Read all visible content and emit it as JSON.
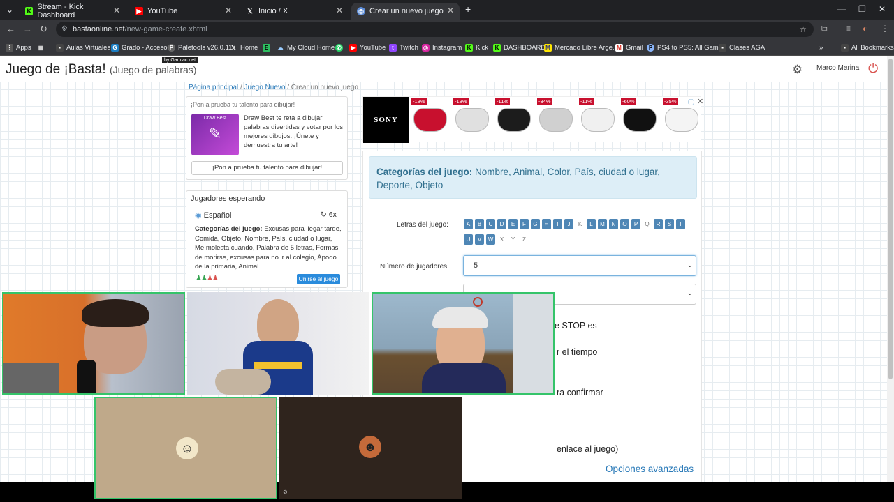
{
  "browser": {
    "tabs": [
      {
        "title": "Stream - Kick Dashboard",
        "icon": "kick-icon"
      },
      {
        "title": "YouTube",
        "icon": "youtube-icon"
      },
      {
        "title": "Inicio / X",
        "icon": "x-icon"
      },
      {
        "title": "Crear un nuevo juego",
        "icon": "globe-icon"
      }
    ],
    "url_domain": "bastaonline.net",
    "url_path": "/new-game-create.xhtml",
    "bookmarks": [
      "Apps",
      "Aulas Virtuales",
      "Grado - Acceso",
      "Paletools v26.0.11",
      "Home",
      "My Cloud Home",
      "YouTube",
      "Twitch",
      "Instagram",
      "Kick",
      "DASHBOARD",
      "Mercado Libre Arge...",
      "Gmail",
      "PS4 to PS5: All Gam...",
      "Clases AGA"
    ],
    "all_bookmarks": "All Bookmarks"
  },
  "site": {
    "title": "Juego de ¡Basta!",
    "subtitle": "(Juego de palabras)",
    "gamiac_badge": "by Gamiac.net",
    "username": "Marco Marina"
  },
  "breadcrumb": {
    "home": "Página principal",
    "new_game": "Juego Nuevo",
    "current": "Crear un nuevo juego"
  },
  "draw_promo": {
    "title": "¡Pon a prueba tu talento para dibujar!",
    "image_text": "Draw Best",
    "text": "Draw Best te reta a dibujar palabras divertidas y votar por los mejores dibujos. ¡Únete y demuestra tu arte!",
    "button": "¡Pon a prueba tu talento para dibujar!"
  },
  "waiting": {
    "title": "Jugadores esperando",
    "language": "Español",
    "count": "6x",
    "categories_label": "Categorías del juego:",
    "categories": "Excusas para llegar tarde, Comida, Objeto, Nombre, País, ciudad o lugar, Me molesta cuando, Palabra de 5 letras, Formas de morirse, excusas para no ir al colegio, Apodo de la primaria, Animal",
    "players_icons": "♟♟♟♟",
    "join_button": "Unirse al juego"
  },
  "ad": {
    "brand": "SONY",
    "items": [
      {
        "discount": "-18%",
        "color": "#c8102e"
      },
      {
        "discount": "-18%",
        "color": "#e0e0e0"
      },
      {
        "discount": "-11%",
        "color": "#1c1c1c"
      },
      {
        "discount": "-34%",
        "color": "#d0d0d0"
      },
      {
        "discount": "-11%",
        "color": "#f0f0f0"
      },
      {
        "discount": "-60%",
        "color": "#111111"
      },
      {
        "discount": "-35%",
        "color": "#f4f4f4"
      }
    ]
  },
  "form": {
    "categories_label": "Categorías del juego:",
    "categories": "Nombre, Animal, Color, País, ciudad o lugar, Deporte, Objeto",
    "letters_label": "Letras del juego:",
    "letters": [
      {
        "l": "A",
        "on": true
      },
      {
        "l": "B",
        "on": true
      },
      {
        "l": "C",
        "on": true
      },
      {
        "l": "D",
        "on": true
      },
      {
        "l": "E",
        "on": true
      },
      {
        "l": "F",
        "on": true
      },
      {
        "l": "G",
        "on": true
      },
      {
        "l": "H",
        "on": true
      },
      {
        "l": "I",
        "on": true
      },
      {
        "l": "J",
        "on": true
      },
      {
        "l": "K",
        "on": false
      },
      {
        "l": "L",
        "on": true
      },
      {
        "l": "M",
        "on": true
      },
      {
        "l": "N",
        "on": true
      },
      {
        "l": "O",
        "on": true
      },
      {
        "l": "P",
        "on": true
      },
      {
        "l": "Q",
        "on": false
      },
      {
        "l": "R",
        "on": true
      },
      {
        "l": "S",
        "on": true
      },
      {
        "l": "T",
        "on": true
      },
      {
        "l": "U",
        "on": true
      },
      {
        "l": "V",
        "on": true
      },
      {
        "l": "W",
        "on": true
      },
      {
        "l": "X",
        "on": false
      },
      {
        "l": "Y",
        "on": false
      },
      {
        "l": "Z",
        "on": false
      }
    ],
    "players_label": "Número de jugadores:",
    "players_value": "5",
    "row_stop": "e STOP es",
    "row_time": "r el tiempo",
    "row_confirm": "ra confirmar",
    "row_link": "enlace al juego)",
    "advanced": "Opciones avanzadas"
  },
  "colors": {
    "accent": "#2a7ab8",
    "active_cam_border": "#35c46a",
    "logout": "#d9534f"
  }
}
